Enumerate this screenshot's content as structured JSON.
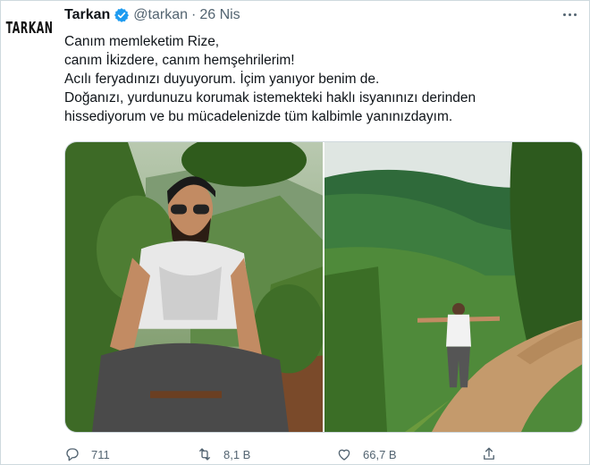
{
  "tweet": {
    "avatar_text": "TARKAN",
    "name": "Tarkan",
    "handle": "@tarkan",
    "separator": "·",
    "date": "26 Nis",
    "lines": [
      "Canım memleketim Rize,",
      "canım İkizdere, canım hemşehrilerim!",
      "Acılı feryadınızı duyuyorum. İçim yanıyor benim de.",
      "Doğanızı, yurdunuzu korumak istemekteki haklı isyanınızı derinden",
      "hissediyorum ve bu mücadelenizde tüm kalbimle yanınızdayım."
    ]
  },
  "icons": {
    "verified": "verified-badge-icon",
    "more": "more-options-icon",
    "reply": "reply-icon",
    "retweet": "retweet-icon",
    "like": "heart-icon",
    "share": "share-icon"
  },
  "actions": {
    "reply_count": "711",
    "retweet_count": "8,1 B",
    "like_count": "66,7 B"
  },
  "colors": {
    "verified": "#1d9bf0",
    "secondary_text": "#536471",
    "border": "#cfd9de"
  }
}
